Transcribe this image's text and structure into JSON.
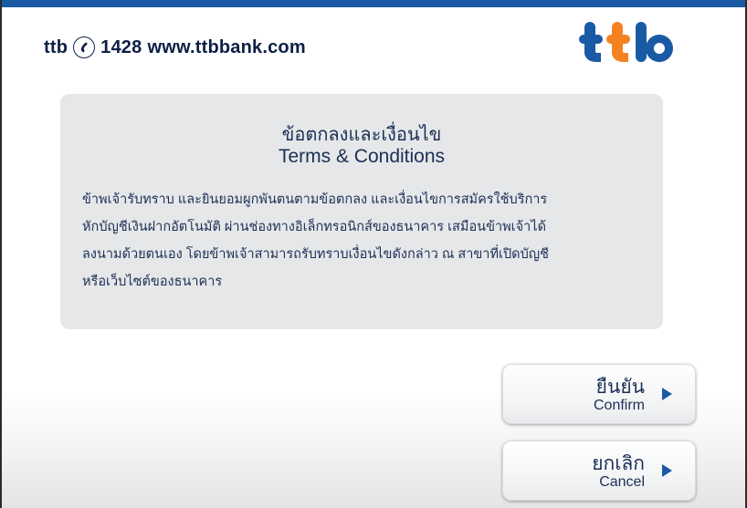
{
  "header": {
    "brand": "ttb",
    "phone": "1428",
    "website": "www.ttbbank.com",
    "logo_text": "ttb"
  },
  "terms": {
    "title_th": "ข้อตกลงและเงื่อนไข",
    "title_en": "Terms & Conditions",
    "body_lines": [
      "ข้าพเจ้ารับทราบ และยินยอมผูกพันตนตามข้อตกลง และเงื่อนไขการสมัครใช้บริการ",
      "หักบัญชีเงินฝากอัตโนมัติ ผ่านช่องทางอิเล็กทรอนิกส์ของธนาคาร เสมือนข้าพเจ้าได้",
      "ลงนามด้วยตนเอง โดยข้าพเจ้าสามารถรับทราบเงื่อนไขดังกล่าว ณ สาขาที่เปิดบัญชี",
      "หรือเว็บไซต์ของธนาคาร"
    ]
  },
  "buttons": {
    "confirm": {
      "th": "ยืนยัน",
      "en": "Confirm"
    },
    "cancel": {
      "th": "ยกเลิก",
      "en": "Cancel"
    }
  },
  "colors": {
    "brand_blue": "#1a5aa5",
    "brand_orange": "#f58220",
    "navy_text": "#0d1f45"
  },
  "icons": [
    "phone-icon",
    "arrow-right-icon"
  ]
}
